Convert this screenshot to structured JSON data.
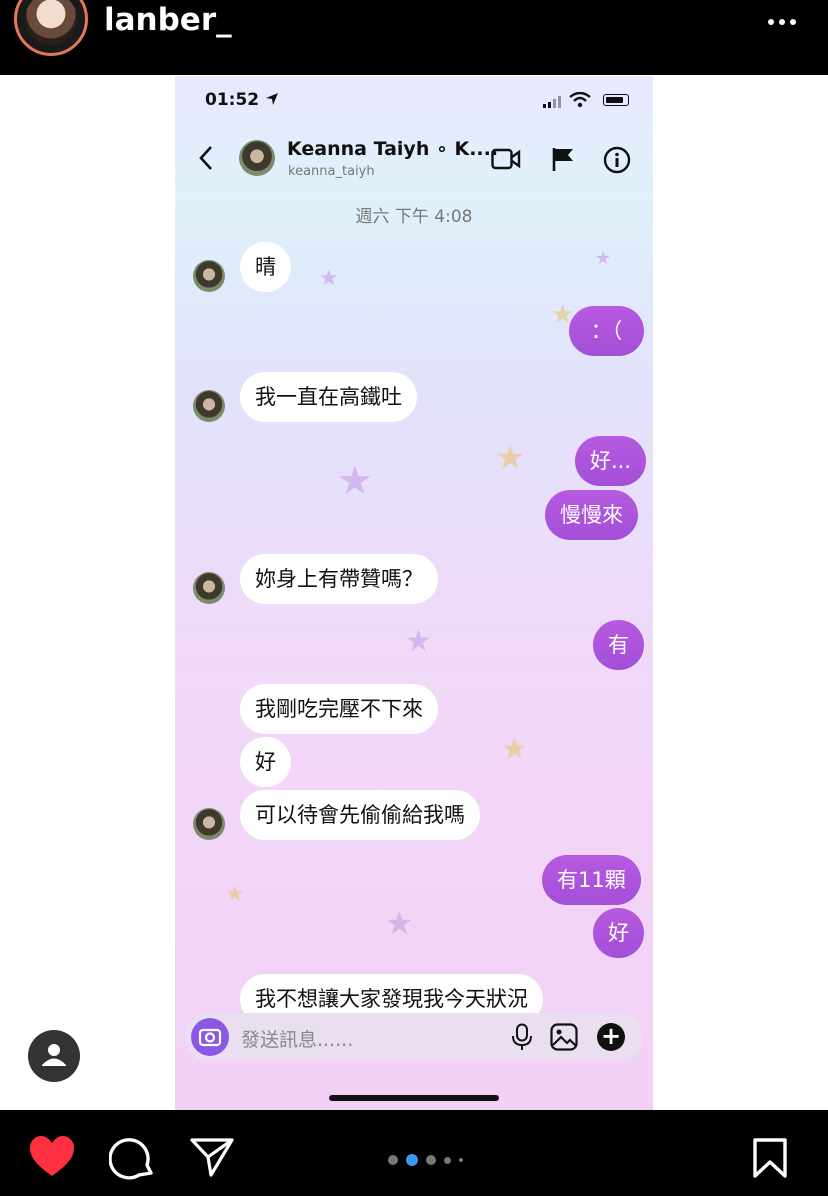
{
  "story": {
    "username": "lanber_",
    "icons": {
      "more": "more-dots-icon",
      "profile": "profile-icon"
    }
  },
  "status_bar": {
    "time": "01:52"
  },
  "chat_header": {
    "name": "Keanna Taiyh ∘ K....",
    "handle": "keanna_taiyh",
    "icons": [
      "back-chevron-icon",
      "video-call-icon",
      "flag-icon",
      "info-icon"
    ]
  },
  "thread": {
    "date": "週六 下午 4:08",
    "messages": [
      {
        "side": "in",
        "text": "晴"
      },
      {
        "side": "out",
        "text": "：（"
      },
      {
        "side": "in",
        "text": "我一直在高鐵吐"
      },
      {
        "side": "out",
        "text": "好..."
      },
      {
        "side": "out",
        "text": "慢慢來"
      },
      {
        "side": "in",
        "text": "妳身上有帶贊嗎？"
      },
      {
        "side": "out",
        "text": "有"
      },
      {
        "side": "in",
        "text": "我剛吃完壓不下來"
      },
      {
        "side": "in",
        "text": "好"
      },
      {
        "side": "in",
        "text": "可以待會先偷偷給我嗎"
      },
      {
        "side": "out",
        "text": "有11顆"
      },
      {
        "side": "out",
        "text": "好"
      },
      {
        "side": "in",
        "text": "我不想讓大家發現我今天狀況"
      }
    ]
  },
  "composer": {
    "placeholder": "發送訊息......"
  },
  "colors": {
    "outgoing_bubble": "#a94fdc",
    "incoming_bubble": "#ffffff",
    "like_heart": "#ff3040",
    "active_dot": "#3897f0"
  },
  "bottom_bar": {
    "icons": [
      "heart-icon",
      "comment-icon",
      "send-icon",
      "bookmark-icon"
    ],
    "pager": {
      "count": 5,
      "active": 1
    }
  }
}
